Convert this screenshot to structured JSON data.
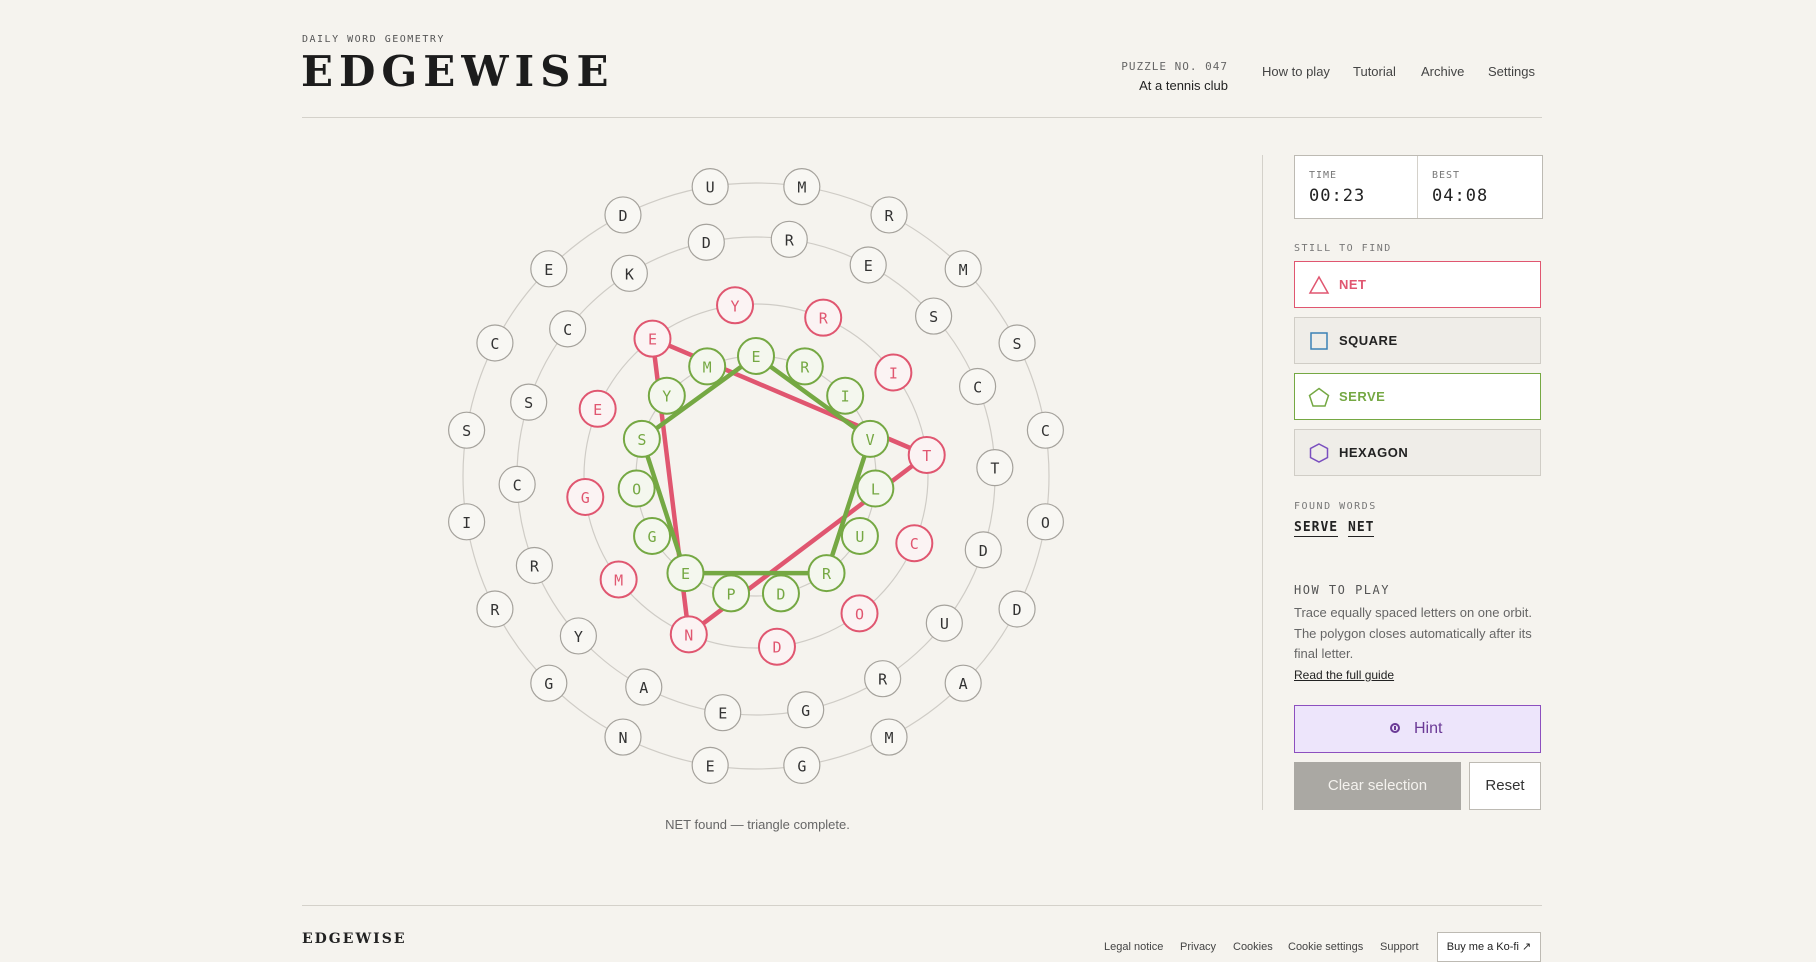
{
  "header": {
    "kicker": "DAILY WORD GEOMETRY",
    "brand": "EDGEWISE",
    "puzzle_number": "PUZZLE NO. 047",
    "puzzle_theme": "At a tennis club",
    "nav": [
      "How to play",
      "Tutorial",
      "Archive",
      "Settings"
    ]
  },
  "colors": {
    "net": "#e05670",
    "serve": "#75a843",
    "square": "#3b82b5",
    "hexagon": "#7a4fbf",
    "orbit": "#cfccc6",
    "node_border": "#a5a29c"
  },
  "board": {
    "orbits": [
      {
        "ring": 1,
        "letters": [
          "E",
          "R",
          "I",
          "V",
          "L",
          "U",
          "R",
          "D",
          "P",
          "E",
          "G",
          "O",
          "S",
          "Y",
          "M"
        ]
      },
      {
        "ring": 2,
        "letters": [
          "R",
          "I",
          "T",
          "C",
          "O",
          "D",
          "N",
          "M",
          "G",
          "E",
          "E",
          "Y"
        ]
      },
      {
        "ring": 3,
        "letters": [
          "D",
          "R",
          "E",
          "S",
          "C",
          "T",
          "D",
          "U",
          "R",
          "G",
          "E",
          "A",
          "Y",
          "R",
          "C",
          "S",
          "C",
          "K"
        ]
      },
      {
        "ring": 4,
        "letters": [
          "M",
          "R",
          "M",
          "S",
          "C",
          "O",
          "D",
          "A",
          "M",
          "G",
          "E",
          "N",
          "G",
          "R",
          "I",
          "S",
          "C",
          "E",
          "D",
          "U"
        ]
      }
    ],
    "found_paths": [
      {
        "word": "NET",
        "shape": "triangle",
        "color": "#e05670",
        "letters": [
          "N",
          "E",
          "T"
        ]
      },
      {
        "word": "SERVE",
        "shape": "pentagon",
        "color": "#75a843",
        "letters": [
          "S",
          "E",
          "R",
          "V",
          "E"
        ]
      }
    ]
  },
  "status_text": "NET found — triangle complete.",
  "timer": {
    "time_label": "TIME",
    "time_value": "00:23",
    "best_label": "BEST",
    "best_value": "04:08"
  },
  "still_to_find": {
    "label": "STILL TO FIND",
    "items": [
      {
        "label": "NET",
        "icon": "triangle-icon",
        "color": "#e05670"
      },
      {
        "label": "SQUARE",
        "icon": "square-icon",
        "color": "#3b82b5"
      },
      {
        "label": "SERVE",
        "icon": "pentagon-icon",
        "color": "#75a843"
      },
      {
        "label": "HEXAGON",
        "icon": "hexagon-icon",
        "color": "#7a4fbf"
      }
    ]
  },
  "found_words": {
    "label": "FOUND WORDS",
    "words": [
      "SERVE",
      "NET"
    ]
  },
  "how_to_play": {
    "title": "HOW TO PLAY",
    "body": "Trace equally spaced letters on one orbit. The polygon closes automatically after its final letter.",
    "link": "Read the full guide"
  },
  "buttons": {
    "hint": "Hint",
    "clear": "Clear selection",
    "reset": "Reset"
  },
  "footer": {
    "brand": "EDGEWISE",
    "links": [
      "Legal notice",
      "Privacy",
      "Cookies",
      "Cookie settings",
      "Support"
    ],
    "kofi": "Buy me a Ko-fi ↗"
  }
}
